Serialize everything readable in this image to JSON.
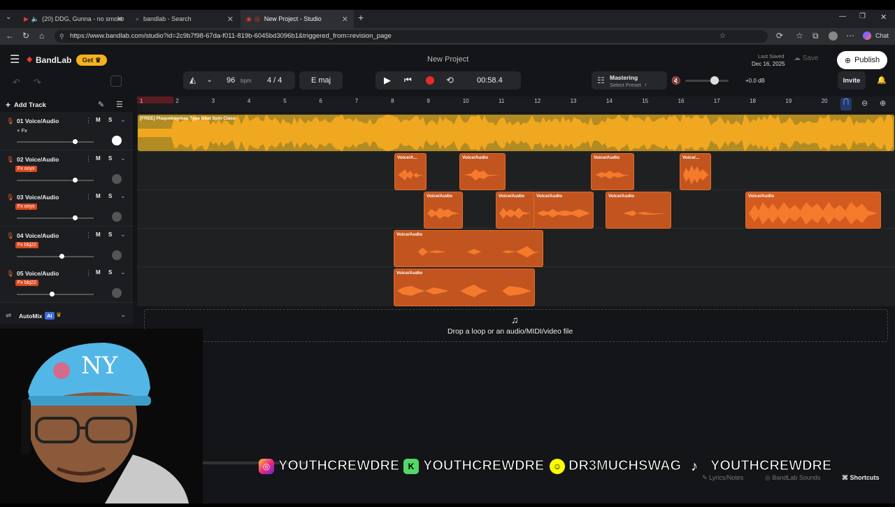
{
  "browser": {
    "tabs": [
      {
        "title": "(20) DDG, Gunna - no smoke",
        "active": false
      },
      {
        "title": "bandlab - Search",
        "active": false
      },
      {
        "title": "New Project - Studio",
        "active": true
      }
    ],
    "url": "https://www.bandlab.com/studio?id=2c9b7f98-67da-f011-819b-6045bd3096b1&triggered_from=revision_page",
    "chat_label": "Chat"
  },
  "header": {
    "brand": "BandLab",
    "get_label": "Get",
    "project_title": "New Project",
    "last_saved_label": "Last Saved",
    "last_saved_date": "Dec 16, 2025",
    "save_label": "Save",
    "publish_label": "Publish"
  },
  "toolbar": {
    "bpm_value": "96",
    "bpm_unit": "bpm",
    "time_signature": "4 / 4",
    "key": "E maj",
    "time": "00:58.4",
    "mastering_label": "Mastering",
    "mastering_preset": "Select Preset",
    "volume_db": "+0.0 dB",
    "invite_label": "Invite"
  },
  "ruler": {
    "ticks": [
      "1",
      "2",
      "3",
      "4",
      "5",
      "6",
      "7",
      "8",
      "9",
      "10",
      "11",
      "12",
      "13",
      "14",
      "15",
      "16",
      "17",
      "18",
      "19",
      "20"
    ]
  },
  "left": {
    "add_track_label": "Add Track",
    "automix_label": "AutoMix",
    "ai_badge": "AI"
  },
  "tracks": [
    {
      "name": "01  Voice/Audio",
      "fx": "+ Fx",
      "fx_is_tag": false,
      "volume_fraction": 0.75
    },
    {
      "name": "02  Voice/Audio",
      "fx": "Fx onyx",
      "fx_is_tag": true,
      "volume_fraction": 0.75
    },
    {
      "name": "03  Voice/Audio",
      "fx": "Fx onyx",
      "fx_is_tag": true,
      "volume_fraction": 0.75
    },
    {
      "name": "04  Voice/Audio",
      "fx": "Fx bbj22",
      "fx_is_tag": true,
      "volume_fraction": 0.58
    },
    {
      "name": "05  Voice/Audio",
      "fx": "Fx bbj22",
      "fx_is_tag": true,
      "volume_fraction": 0.45
    }
  ],
  "clips": {
    "beat": "[FREE] Plaqueboymax Type Beat Spin Class",
    "voice_short": "Voice/A...",
    "voice": "Voice/Audio",
    "voice_tiny": "Voice/..."
  },
  "dropzone": {
    "text": "Drop a loop or an audio/MIDI/video file"
  },
  "socials": {
    "handle1": "YOUTHCREWDRE",
    "handle2": "YOUTHCREWDRE",
    "handle3": "DR3MUCHSWAG",
    "handle4": "YOUTHCREWDRE"
  },
  "footer": {
    "lyrics": "Lyrics/Notes",
    "sounds": "BandLab Sounds",
    "shortcuts": "Shortcuts"
  },
  "colors": {
    "accent": "#f5b21e",
    "record": "#e52b2b",
    "clip_orange": "#c2551f",
    "clip_yellow": "#f0a820"
  }
}
